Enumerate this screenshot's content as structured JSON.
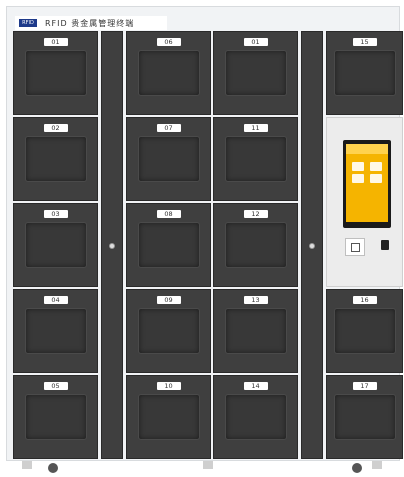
{
  "header": {
    "logo_text": "RFID",
    "title": "RFID 贵金属管理终端"
  },
  "lockers": {
    "col1": [
      "01",
      "02",
      "03",
      "04",
      "05"
    ],
    "col2": [
      "06",
      "07",
      "08",
      "09",
      "10"
    ],
    "col3": [
      "01",
      "11",
      "12",
      "13",
      "14"
    ],
    "col4_top": "15",
    "col4_bottom": [
      "16",
      "17"
    ]
  },
  "colors": {
    "door": "#3f3f3f",
    "screen": "#f5b400",
    "logo": "#1e3a8a"
  }
}
